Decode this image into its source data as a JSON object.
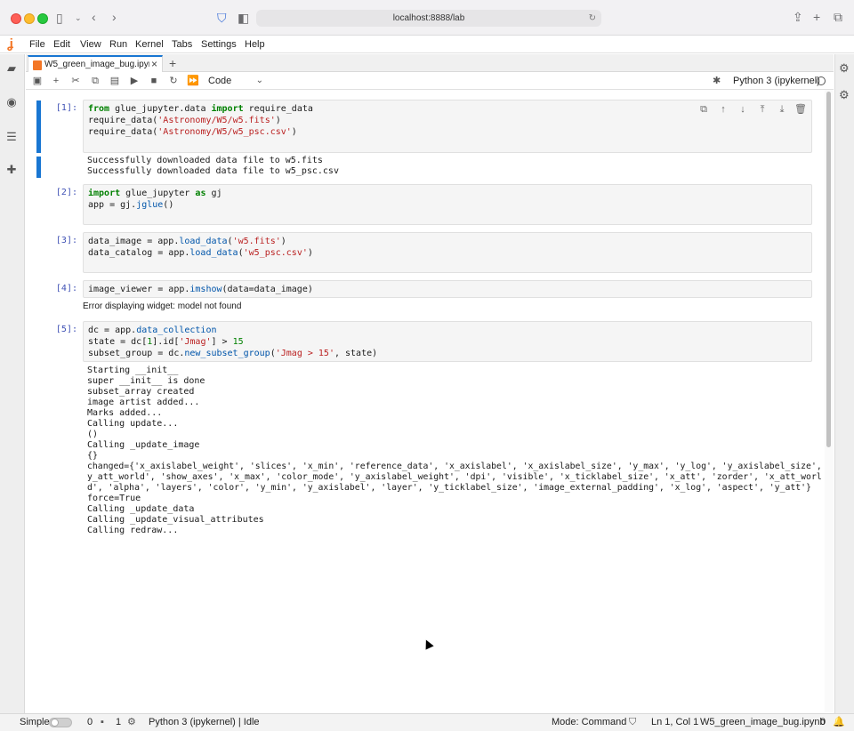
{
  "browser": {
    "url": "localhost:8888/lab"
  },
  "menubar": {
    "items": [
      "File",
      "Edit",
      "View",
      "Run",
      "Kernel",
      "Tabs",
      "Settings",
      "Help"
    ]
  },
  "tab": {
    "title": "W5_green_image_bug.ipynb",
    "close": "×",
    "new": "+"
  },
  "toolbar": {
    "cell_type": "Code",
    "kernel": "Python 3 (ipykernel)"
  },
  "cells": [
    {
      "prompt": "[1]:",
      "code_lines": [
        "from glue_jupyter.data import require_data",
        "require_data('Astronomy/W5/w5.fits')",
        "require_data('Astronomy/W5/w5_psc.csv')"
      ],
      "output": [
        "Successfully downloaded data file to w5.fits",
        "Successfully downloaded data file to w5_psc.csv"
      ]
    },
    {
      "prompt": "[2]:",
      "code_lines": [
        "import glue_jupyter as gj",
        "app = gj.jglue()"
      ]
    },
    {
      "prompt": "[3]:",
      "code_lines": [
        "data_image = app.load_data('w5.fits')",
        "data_catalog = app.load_data('w5_psc.csv')"
      ]
    },
    {
      "prompt": "[4]:",
      "code_lines": [
        "image_viewer = app.imshow(data=data_image)"
      ],
      "error": "Error displaying widget: model not found"
    },
    {
      "prompt": "[5]:",
      "code_lines": [
        "dc = app.data_collection",
        "state = dc[1].id['Jmag'] > 15",
        "subset_group = dc.new_subset_group('Jmag > 15', state)"
      ],
      "output": [
        "Starting __init__",
        "super __init__ is done",
        "subset_array created",
        "image artist added...",
        "Marks added...",
        "Calling update...",
        "()",
        "Calling _update_image",
        "{}",
        "changed={'x_axislabel_weight', 'slices', 'x_min', 'reference_data', 'x_axislabel', 'x_axislabel_size', 'y_max', 'y_log', 'y_axislabel_size', '",
        "y_att_world', 'show_axes', 'x_max', 'color_mode', 'y_axislabel_weight', 'dpi', 'visible', 'x_ticklabel_size', 'x_att', 'zorder', 'x_att_worl",
        "d', 'alpha', 'layers', 'color', 'y_min', 'y_axislabel', 'layer', 'y_ticklabel_size', 'image_external_padding', 'x_log', 'aspect', 'y_att'}",
        "force=True",
        "Calling _update_data",
        "Calling _update_visual_attributes",
        "Calling redraw..."
      ]
    }
  ],
  "statusbar": {
    "mode_label": "Simple",
    "count_a": "0",
    "count_b": "1",
    "kernel_status": "Python 3 (ipykernel) | Idle",
    "mode": "Mode: Command",
    "position": "Ln 1, Col 1",
    "filename": "W5_green_image_bug.ipynb",
    "notifications": "0"
  },
  "icons": [
    "sidebar-icon",
    "back-icon",
    "forward-icon",
    "shield-icon",
    "share-icon",
    "new-tab-icon",
    "tabs-overview-icon",
    "folder-icon",
    "running-icon",
    "toc-icon",
    "extension-icon",
    "property-inspector-icon",
    "save-icon",
    "add-cell-icon",
    "cut-icon",
    "copy-icon",
    "paste-icon",
    "run-icon",
    "stop-icon",
    "restart-icon",
    "run-all-icon",
    "bug-icon",
    "duplicate-icon",
    "move-up-icon",
    "move-down-icon",
    "insert-above-icon",
    "insert-below-icon",
    "delete-icon",
    "bell-icon"
  ],
  "colors": {
    "accent": "#1976d2",
    "jupyter_orange": "#f37626",
    "keyword": "#008000",
    "string": "#ba2121"
  }
}
